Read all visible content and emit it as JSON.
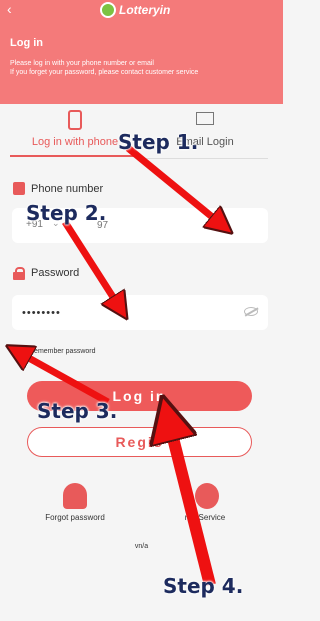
{
  "header": {
    "back_icon": "chevron-left-icon",
    "logo_text": "Lotteryin",
    "title": "Log in",
    "subtitle_1": "Please log in with your phone number or email",
    "subtitle_2": "If you forget your password, please contact customer service"
  },
  "tabs": [
    {
      "label": "Log in with phone",
      "icon": "phone-icon",
      "active": true
    },
    {
      "label": "Email Login",
      "icon": "mail-icon",
      "active": false
    }
  ],
  "phone": {
    "label": "Phone number",
    "country_code": "+91",
    "placeholder": "97"
  },
  "password": {
    "label": "Password",
    "value": "••••••••"
  },
  "remember": {
    "label": "Remember password",
    "checked": true
  },
  "buttons": {
    "login": "Log in",
    "register": "Regis"
  },
  "bottom": [
    {
      "label": "Forgot password",
      "icon": "lock-pin-icon"
    },
    {
      "label": "ner Service",
      "icon": "customer-service-icon"
    }
  ],
  "version": "vn/a",
  "annotations": {
    "step1": "Step 1.",
    "step2": "Step 2.",
    "step3": "Step 3.",
    "step4": "Step 4."
  },
  "colors": {
    "brand": "#f47a7a",
    "accent": "#e85a5a",
    "arrow": "#ee1111",
    "step_text": "#1d2b5e"
  }
}
